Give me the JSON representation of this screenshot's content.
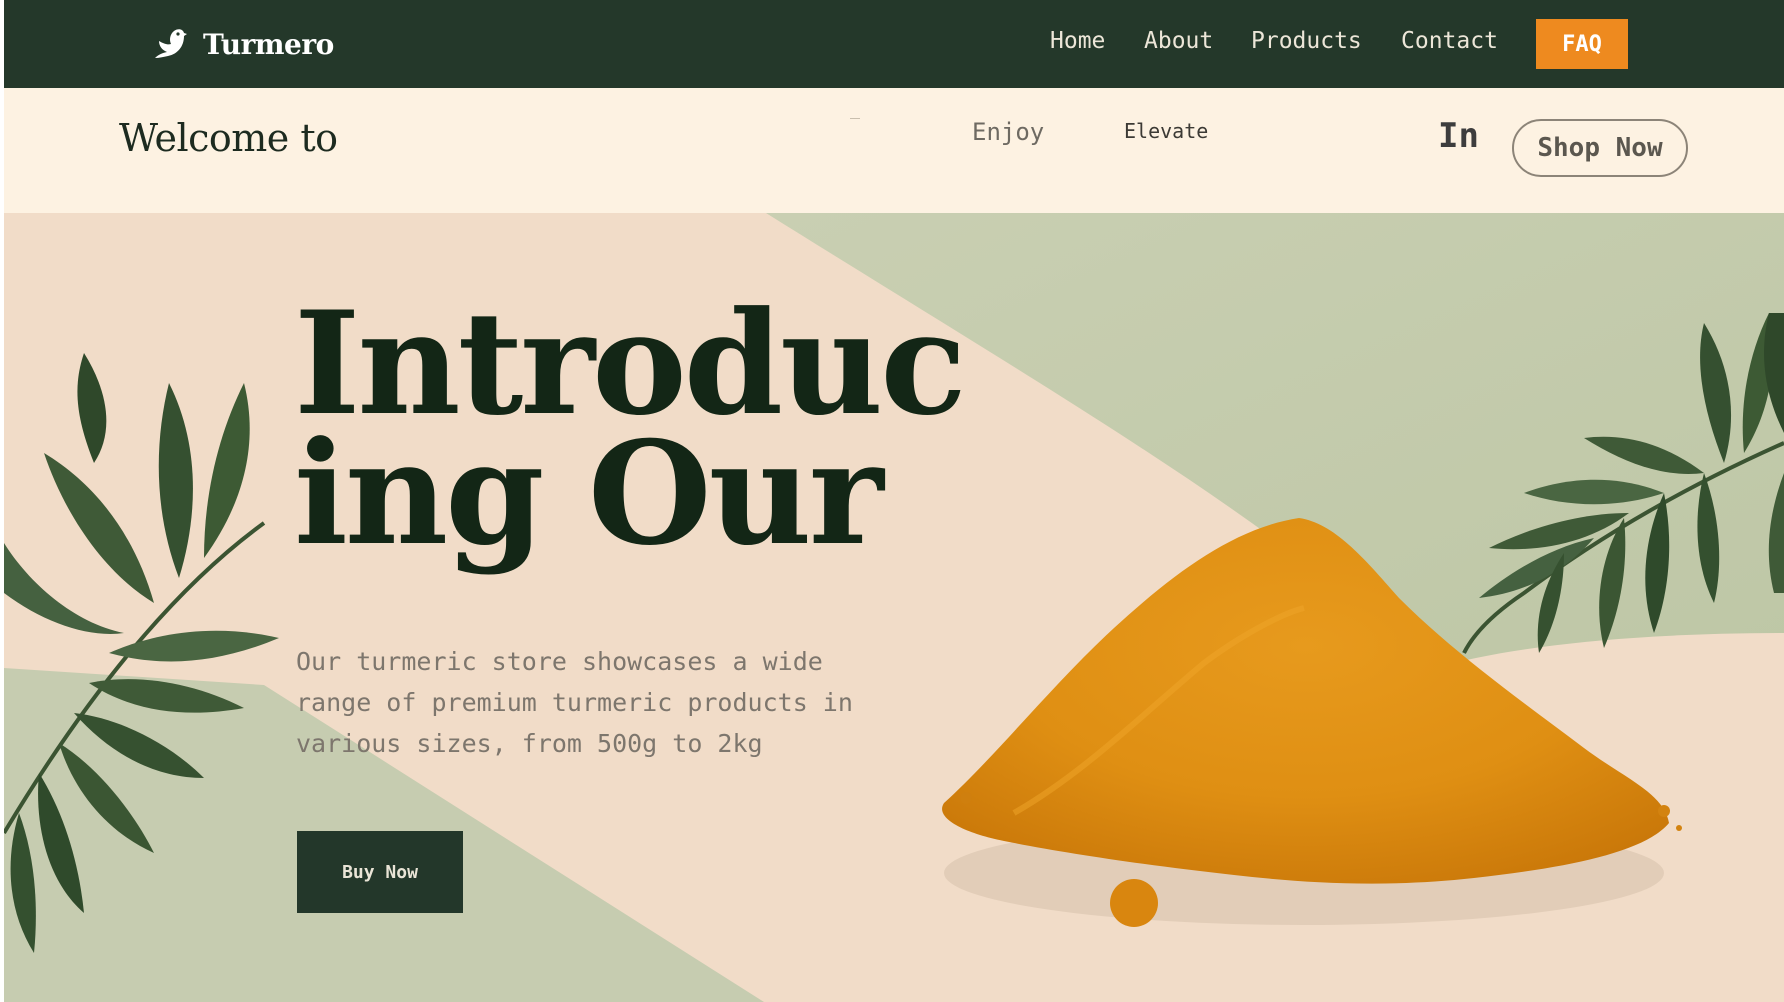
{
  "navbar": {
    "brand": {
      "name": "Turmero",
      "icon": "bird-icon"
    },
    "links": [
      {
        "label": "Home"
      },
      {
        "label": "About"
      },
      {
        "label": "Products"
      },
      {
        "label": "Contact"
      }
    ],
    "faq_label": "FAQ"
  },
  "strip": {
    "welcome": "Welcome to",
    "dash": "–",
    "enjoy": "Enjoy",
    "elevate": "Elevate",
    "in_text": "In",
    "shop_label": "Shop Now"
  },
  "hero": {
    "title_line1": "Introduc",
    "title_line2": "ing Our",
    "description": "Our turmeric store showcases a wide range of premium turmeric products in various sizes, from 500g to 2kg",
    "buy_label": "Buy Now",
    "image": "turmeric-powder-heap-with-palm-leaves"
  },
  "colors": {
    "navbar_bg": "#24382a",
    "accent_orange": "#ee8a1f",
    "strip_bg": "#fdf2e2",
    "hero_bg": "#f1dcc8",
    "hero_green": "#c6ccb0",
    "title_dark": "#132616",
    "turmeric": "#e08f14",
    "leaf": "#3f5a37"
  }
}
